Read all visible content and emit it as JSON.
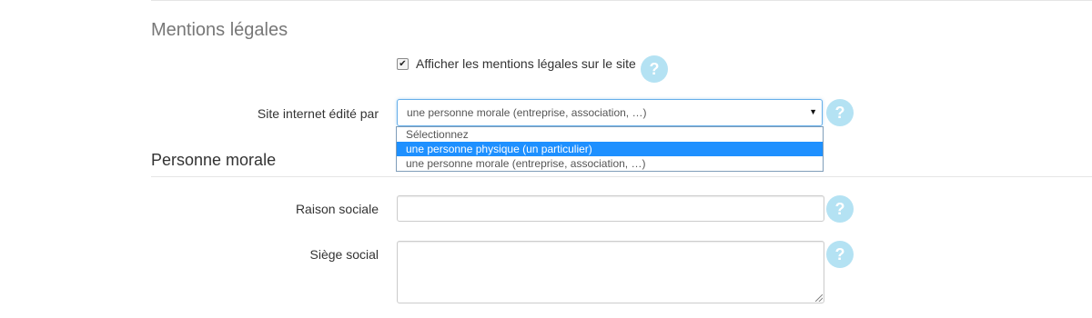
{
  "section": {
    "title": "Mentions légales",
    "show_legal_checkbox": {
      "label": "Afficher les mentions légales sur le site",
      "checked": true,
      "check_glyph": "✔"
    }
  },
  "site_editor": {
    "label": "Site internet édité par",
    "selected_value": "une personne morale (entreprise, association, …)",
    "arrow_glyph": "▼",
    "options": [
      "Sélectionnez",
      "une personne physique (un particulier)",
      "une personne morale (entreprise, association, …)"
    ],
    "highlighted_option_index": 1
  },
  "personne_morale": {
    "title": "Personne morale",
    "raison_sociale_label": "Raison sociale",
    "raison_sociale_value": "",
    "siege_social_label": "Siège social",
    "siege_social_value": ""
  },
  "help": {
    "glyph": "?",
    "icon": "question-circle-icon",
    "color": "#b4e2f3"
  },
  "colors": {
    "highlight": "#1e90ff",
    "focus_border": "#66afe9"
  }
}
